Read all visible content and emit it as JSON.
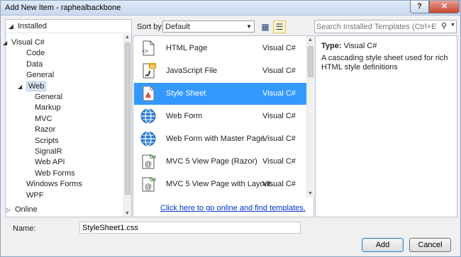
{
  "window": {
    "title": "Add New Item - raphealbackbone",
    "help_label": "?",
    "close_label": "✕"
  },
  "left": {
    "installed_label": "Installed",
    "tree": [
      {
        "label": "Visual C#",
        "level": 0,
        "expanded": true
      },
      {
        "label": "Code",
        "level": 1
      },
      {
        "label": "Data",
        "level": 1
      },
      {
        "label": "General",
        "level": 1
      },
      {
        "label": "Web",
        "level": 1,
        "expanded": true,
        "selected": true
      },
      {
        "label": "General",
        "level": 2
      },
      {
        "label": "Markup",
        "level": 2
      },
      {
        "label": "MVC",
        "level": 2
      },
      {
        "label": "Razor",
        "level": 2
      },
      {
        "label": "Scripts",
        "level": 2
      },
      {
        "label": "SignalR",
        "level": 2
      },
      {
        "label": "Web API",
        "level": 2
      },
      {
        "label": "Web Forms",
        "level": 2
      },
      {
        "label": "Windows Forms",
        "level": 1
      },
      {
        "label": "WPF",
        "level": 1
      }
    ],
    "online_label": "Online"
  },
  "sort": {
    "label": "Sort by:",
    "value": "Default"
  },
  "search": {
    "placeholder": "Search Installed Templates (Ctrl+E)"
  },
  "templates": [
    {
      "name": "HTML Page",
      "lang": "Visual C#",
      "icon": "html-page-icon"
    },
    {
      "name": "JavaScript File",
      "lang": "Visual C#",
      "icon": "javascript-file-icon"
    },
    {
      "name": "Style Sheet",
      "lang": "Visual C#",
      "icon": "style-sheet-icon",
      "selected": true
    },
    {
      "name": "Web Form",
      "lang": "Visual C#",
      "icon": "globe-icon"
    },
    {
      "name": "Web Form with Master Page",
      "lang": "Visual C#",
      "icon": "globe-icon"
    },
    {
      "name": "MVC 5 View Page (Razor)",
      "lang": "Visual C#",
      "icon": "razor-page-icon"
    },
    {
      "name": "MVC 5 View Page with Layout...",
      "lang": "Visual C#",
      "icon": "razor-page-icon"
    }
  ],
  "online_link": "Click here to go online and find templates.",
  "details": {
    "type_label": "Type:",
    "type_value": "Visual C#",
    "description": "A cascading style sheet used for rich HTML style definitions"
  },
  "bottom": {
    "name_label": "Name:",
    "name_value": "StyleSheet1.css",
    "add_label": "Add",
    "cancel_label": "Cancel"
  },
  "colors": {
    "selection": "#3399ff",
    "link": "#0033cc",
    "tree_selection": "#dce6f4"
  }
}
